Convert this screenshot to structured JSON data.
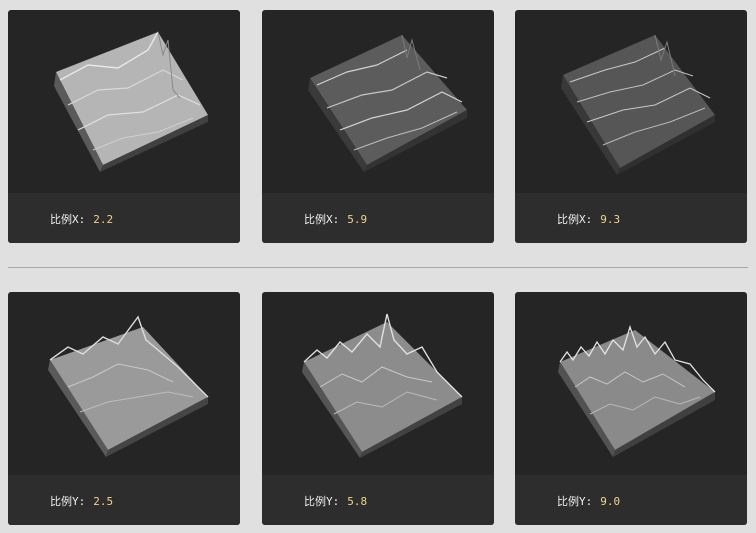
{
  "colors": {
    "page_background": "#e0e0e0",
    "card_background": "#252525",
    "footer_background": "#2d2d2d",
    "label_color": "#f0f0f0",
    "value_color": "#f2d38a",
    "divider_color": "#a8a8a8"
  },
  "separator": ":",
  "rows": [
    {
      "cards": [
        {
          "label": "比例X",
          "value": "2.2",
          "image": "terrain-heightmap-render"
        },
        {
          "label": "比例X",
          "value": "5.9",
          "image": "terrain-heightmap-render"
        },
        {
          "label": "比例X",
          "value": "9.3",
          "image": "terrain-heightmap-render"
        }
      ]
    },
    {
      "cards": [
        {
          "label": "比例Y",
          "value": "2.5",
          "image": "terrain-heightmap-render"
        },
        {
          "label": "比例Y",
          "value": "5.8",
          "image": "terrain-heightmap-render"
        },
        {
          "label": "比例Y",
          "value": "9.0",
          "image": "terrain-heightmap-render"
        }
      ]
    }
  ]
}
